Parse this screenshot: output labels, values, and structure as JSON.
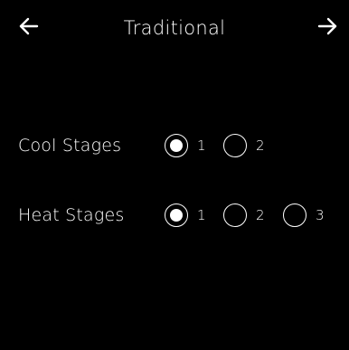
{
  "header": {
    "title": "Traditional",
    "back_icon": "arrow-left-icon",
    "next_icon": "arrow-right-icon"
  },
  "cool_stages": {
    "label": "Cool Stages",
    "options": [
      "1",
      "2"
    ],
    "selected": "1"
  },
  "heat_stages": {
    "label": "Heat Stages",
    "options": [
      "1",
      "2",
      "3"
    ],
    "selected": "1"
  },
  "colors": {
    "background": "#000000",
    "foreground": "#ffffff"
  }
}
